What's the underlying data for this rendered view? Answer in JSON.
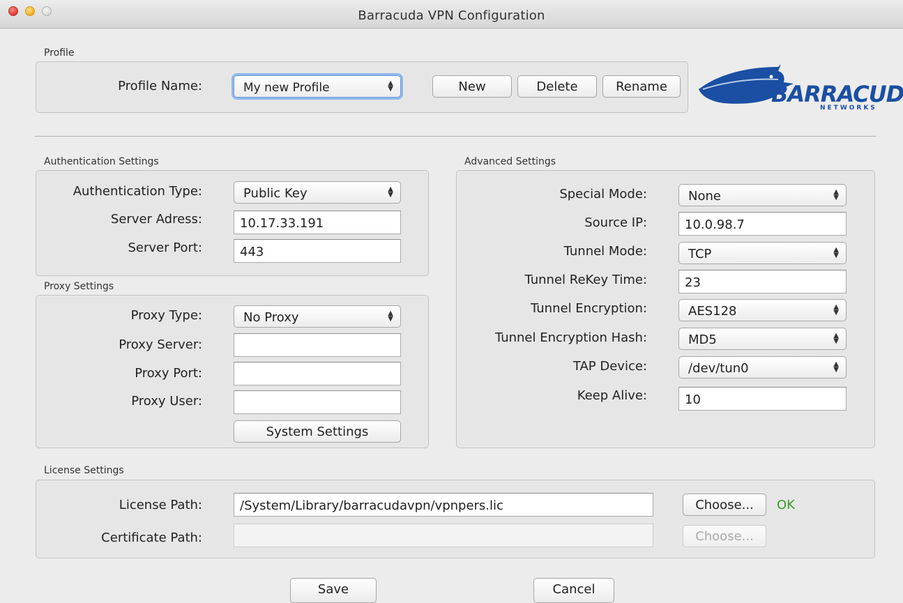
{
  "window": {
    "title": "Barracuda VPN Configuration"
  },
  "profile": {
    "group_label": "Profile",
    "name_label": "Profile Name:",
    "name_value": "My new Profile",
    "new_button": "New",
    "delete_button": "Delete",
    "rename_button": "Rename",
    "logo_text": "BARRACUDA",
    "logo_subtext": "NETWORKS"
  },
  "authentication": {
    "group_label": "Authentication Settings",
    "type_label": "Authentication Type:",
    "type_value": "Public Key",
    "server_address_label": "Server Adress:",
    "server_address_value": "10.17.33.191",
    "server_port_label": "Server Port:",
    "server_port_value": "443"
  },
  "proxy": {
    "group_label": "Proxy Settings",
    "type_label": "Proxy Type:",
    "type_value": "No Proxy",
    "server_label": "Proxy Server:",
    "server_value": "",
    "port_label": "Proxy Port:",
    "port_value": "",
    "user_label": "Proxy User:",
    "user_value": "",
    "system_settings_button": "System Settings"
  },
  "advanced": {
    "group_label": "Advanced Settings",
    "special_mode_label": "Special Mode:",
    "special_mode_value": "None",
    "source_ip_label": "Source IP:",
    "source_ip_value": "10.0.98.7",
    "tunnel_mode_label": "Tunnel Mode:",
    "tunnel_mode_value": "TCP",
    "rekey_label": "Tunnel ReKey Time:",
    "rekey_value": "23",
    "encryption_label": "Tunnel Encryption:",
    "encryption_value": "AES128",
    "hash_label": "Tunnel Encryption Hash:",
    "hash_value": "MD5",
    "tap_label": "TAP Device:",
    "tap_value": "/dev/tun0",
    "keepalive_label": "Keep Alive:",
    "keepalive_value": "10"
  },
  "license": {
    "group_label": "License Settings",
    "license_path_label": "License Path:",
    "license_path_value": "/System/Library/barracudavpn/vpnpers.lic",
    "license_choose_button": "Choose...",
    "license_status": "OK",
    "cert_path_label": "Certificate Path:",
    "cert_path_value": "",
    "cert_choose_button": "Choose..."
  },
  "footer": {
    "save_button": "Save",
    "cancel_button": "Cancel"
  },
  "colors": {
    "ok_status": "#3b9a2c",
    "logo_blue": "#1a4fa3",
    "focus_ring": "#8fb8ec"
  }
}
